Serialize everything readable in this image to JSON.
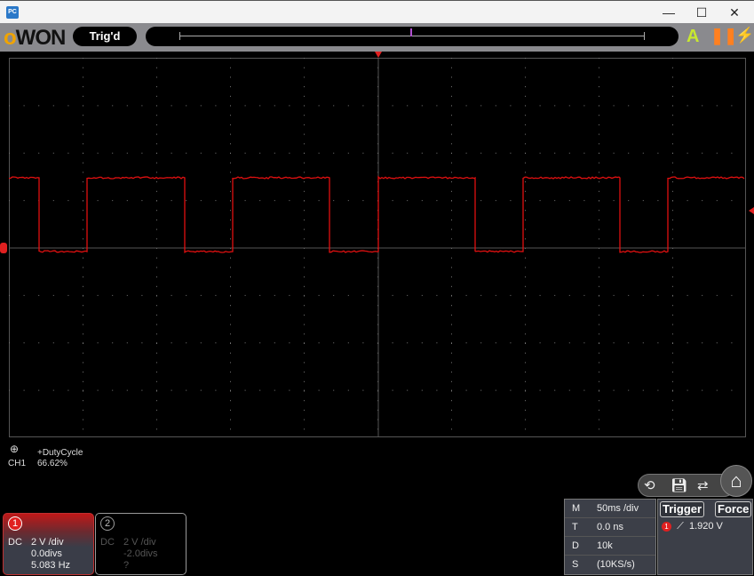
{
  "window": {
    "app_icon": "PC",
    "minimize": "—",
    "maximize": "☐",
    "close": "✕"
  },
  "toolbar": {
    "logo": "OWON",
    "trig_status": "Trig'd",
    "auto_icon": "A",
    "pause_icon": "pause-icon",
    "force_icon": "lightning-icon"
  },
  "measurement": {
    "name": "+DutyCycle",
    "channel": "CH1",
    "value": "66.62%"
  },
  "channels": [
    {
      "num": "1",
      "coupling": "DC",
      "scale": "2 V /div",
      "offset": "0.0divs",
      "freq": "5.083 Hz",
      "color": "#e02020"
    },
    {
      "num": "2",
      "coupling": "DC",
      "scale": "2 V /div",
      "offset": "-2.0divs",
      "freq": "?"
    }
  ],
  "horizontal": [
    {
      "key": "M",
      "value": "50ms /div"
    },
    {
      "key": "T",
      "value": "0.0 ns"
    },
    {
      "key": "D",
      "value": "10k"
    },
    {
      "key": "S",
      "value": "(10KS/s)"
    }
  ],
  "trigger": {
    "label": "Trigger",
    "force": "Force",
    "source": "1",
    "level": "1.920 V"
  },
  "colors": {
    "trace": "#e01010",
    "grid": "#555555"
  }
}
